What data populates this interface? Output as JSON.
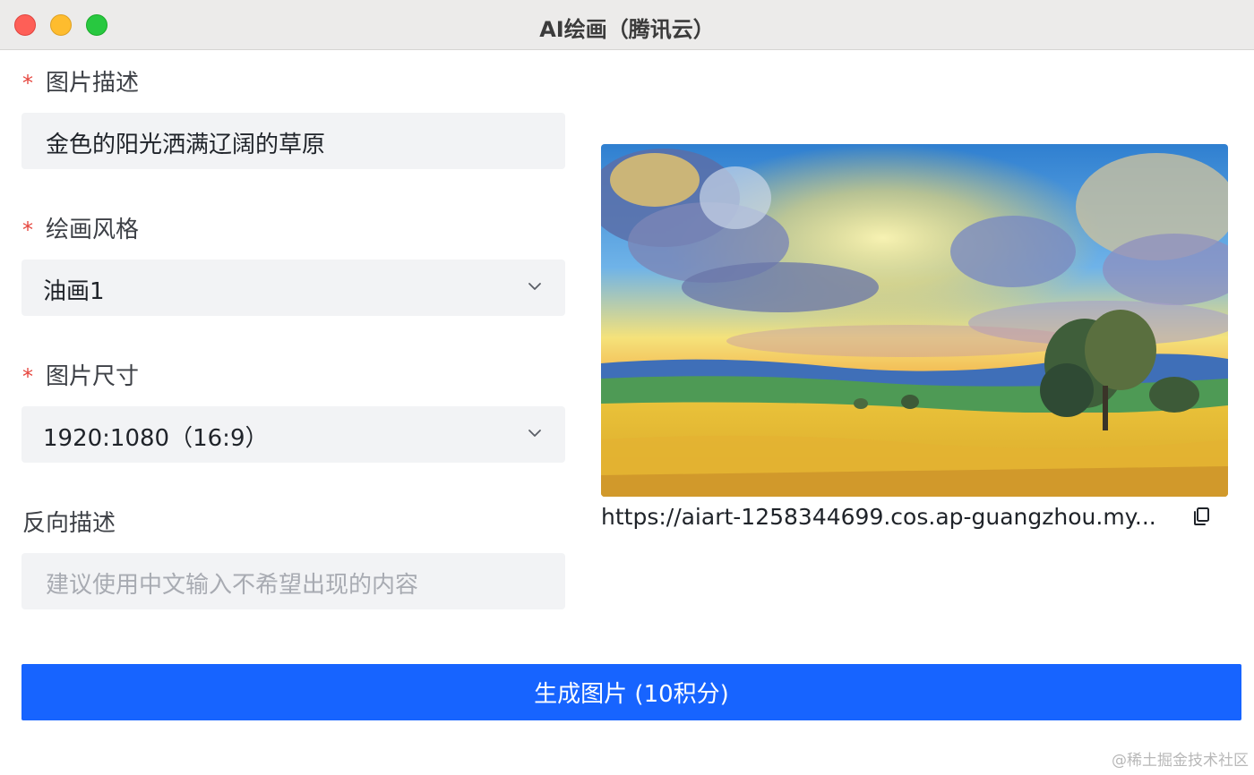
{
  "window": {
    "title": "AI绘画（腾讯云）"
  },
  "form": {
    "description": {
      "required_mark": "*",
      "label": "图片描述",
      "value": "金色的阳光洒满辽阔的草原"
    },
    "style": {
      "required_mark": "*",
      "label": "绘画风格",
      "selected": "油画1"
    },
    "size": {
      "required_mark": "*",
      "label": "图片尺寸",
      "selected": "1920:1080（16:9）"
    },
    "negative": {
      "label": "反向描述",
      "placeholder": "建议使用中文输入不希望出现的内容"
    },
    "generate_button": {
      "label": "生成图片 (10积分)"
    }
  },
  "result": {
    "image_alt": "金色的阳光洒满辽阔的草原",
    "url": "https://aiart-1258344699.cos.ap-guangzhou.my..."
  },
  "watermark": "@稀土掘金技术社区",
  "colors": {
    "accent": "#1764ff",
    "required": "#e6463e",
    "field_bg": "#f2f3f5"
  }
}
